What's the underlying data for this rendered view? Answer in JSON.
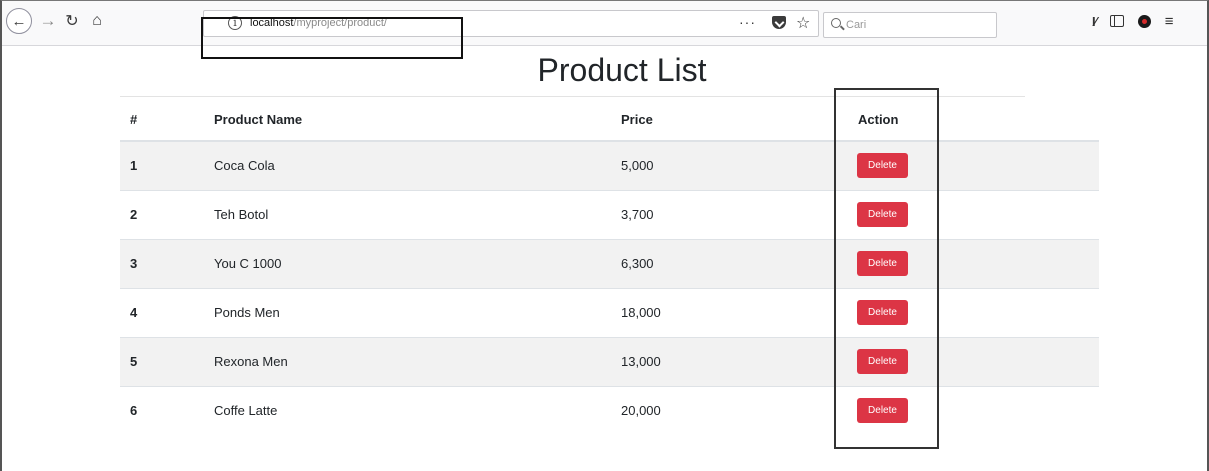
{
  "browser": {
    "url_host": "localhost",
    "url_path": "/myproject/product/",
    "url_more": "···",
    "search_placeholder": "Cari"
  },
  "page": {
    "title": "Product List"
  },
  "table": {
    "headers": [
      "#",
      "Product Name",
      "Price",
      "Action"
    ],
    "rows": [
      {
        "num": "1",
        "name": "Coca Cola",
        "price": "5,000",
        "action": "Delete"
      },
      {
        "num": "2",
        "name": "Teh Botol",
        "price": "3,700",
        "action": "Delete"
      },
      {
        "num": "3",
        "name": "You C 1000",
        "price": "6,300",
        "action": "Delete"
      },
      {
        "num": "4",
        "name": "Ponds Men",
        "price": "18,000",
        "action": "Delete"
      },
      {
        "num": "5",
        "name": "Rexona Men",
        "price": "13,000",
        "action": "Delete"
      },
      {
        "num": "6",
        "name": "Coffe Latte",
        "price": "20,000",
        "action": "Delete"
      }
    ]
  },
  "colors": {
    "delete_button": "#dc3545",
    "stripe": "#f2f2f2"
  }
}
